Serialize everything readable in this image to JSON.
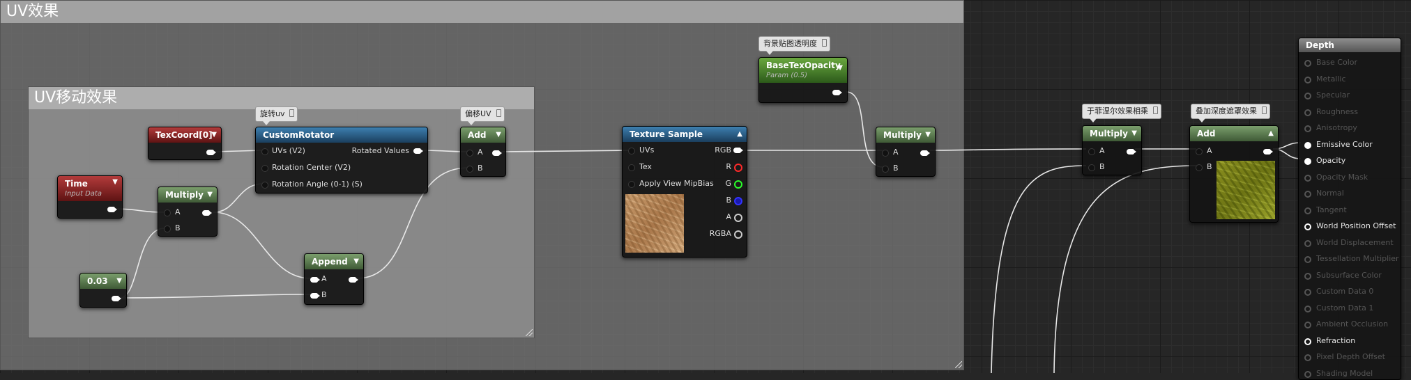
{
  "comments": {
    "outer_title": "UV效果",
    "inner_title": "UV移动效果"
  },
  "bubbles": {
    "rotate": "旋转uv",
    "offset": "偏移UV",
    "bg_opacity": "背景贴图透明度",
    "fresnel": "于菲涅尔效果相乘",
    "depth_mask": "叠加深度遮罩效果"
  },
  "nodes": {
    "texcoord": {
      "title": "TexCoord[0]"
    },
    "time": {
      "title": "Time",
      "subtitle": "Input Data"
    },
    "multiply_time": {
      "title": "Multiply",
      "pins": [
        "A",
        "B"
      ]
    },
    "constant": {
      "title": "0.03"
    },
    "custom_rotator": {
      "title": "CustomRotator",
      "inputs": [
        "UVs (V2)",
        "Rotation Center (V2)",
        "Rotation Angle (0-1) (S)"
      ],
      "output": "Rotated Values"
    },
    "append": {
      "title": "Append",
      "pins": [
        "A",
        "B"
      ]
    },
    "add_uv": {
      "title": "Add",
      "pins": [
        "A",
        "B"
      ]
    },
    "texture_sample": {
      "title": "Texture Sample",
      "inputs": [
        "UVs",
        "Tex",
        "Apply View MipBias"
      ],
      "outputs": [
        "RGB",
        "R",
        "G",
        "B",
        "A",
        "RGBA"
      ]
    },
    "base_tex_opacity": {
      "title": "BaseTexOpacity",
      "subtitle": "Param (0.5)"
    },
    "multiply_opacity": {
      "title": "Multiply",
      "pins": [
        "A",
        "B"
      ]
    },
    "multiply_fresnel": {
      "title": "Multiply",
      "pins": [
        "A",
        "B"
      ]
    },
    "add_depth": {
      "title": "Add",
      "pins": [
        "A",
        "B"
      ]
    }
  },
  "material": {
    "title": "Depth",
    "pins": [
      {
        "label": "Base Color",
        "state": "off"
      },
      {
        "label": "Metallic",
        "state": "off"
      },
      {
        "label": "Specular",
        "state": "off"
      },
      {
        "label": "Roughness",
        "state": "off"
      },
      {
        "label": "Anisotropy",
        "state": "off"
      },
      {
        "label": "Emissive Color",
        "state": "on"
      },
      {
        "label": "Opacity",
        "state": "on"
      },
      {
        "label": "Opacity Mask",
        "state": "off"
      },
      {
        "label": "Normal",
        "state": "off"
      },
      {
        "label": "Tangent",
        "state": "off"
      },
      {
        "label": "World Position Offset",
        "state": "half"
      },
      {
        "label": "World Displacement",
        "state": "off"
      },
      {
        "label": "Tessellation Multiplier",
        "state": "off"
      },
      {
        "label": "Subsurface Color",
        "state": "off"
      },
      {
        "label": "Custom Data 0",
        "state": "off"
      },
      {
        "label": "Custom Data 1",
        "state": "off"
      },
      {
        "label": "Ambient Occlusion",
        "state": "off"
      },
      {
        "label": "Refraction",
        "state": "half"
      },
      {
        "label": "Pixel Depth Offset",
        "state": "off"
      },
      {
        "label": "Shading Model",
        "state": "off"
      }
    ]
  },
  "colors": {
    "math_node": "#5f7f55",
    "param_node": "#8b2424",
    "texture_node": "#2c5f88",
    "vector_param": "#4e8a2a",
    "pin_r": "#ff2a2a",
    "pin_g": "#2aff2a",
    "pin_b": "#2a2aff"
  }
}
